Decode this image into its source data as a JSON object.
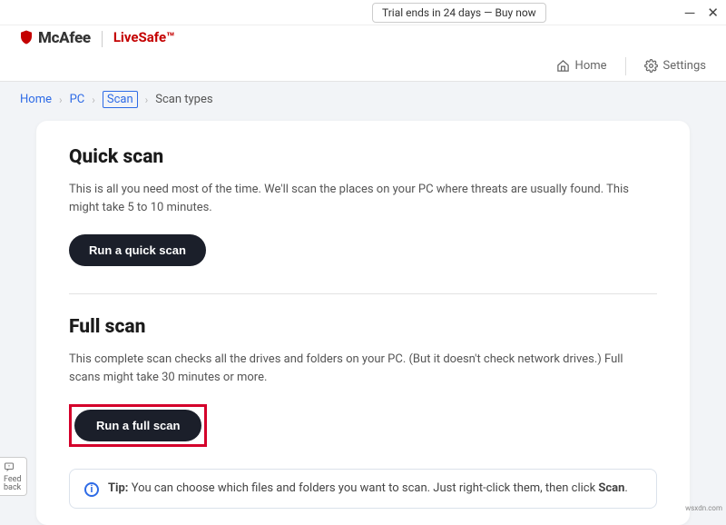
{
  "titlebar": {
    "trial_text": "Trial ends in 24 days — Buy now"
  },
  "brand": {
    "name": "McAfee",
    "product": "LiveSafe™"
  },
  "navbar": {
    "home": "Home",
    "settings": "Settings"
  },
  "crumbs": {
    "home": "Home",
    "pc": "PC",
    "scan": "Scan",
    "types": "Scan types"
  },
  "quick": {
    "title": "Quick scan",
    "text": "This is all you need most of the time. We'll scan the places on your PC where threats are usually found. This might take 5 to 10 minutes.",
    "button": "Run a quick scan"
  },
  "full": {
    "title": "Full scan",
    "text": "This complete scan checks all the drives and folders on your PC. (But it doesn't check network drives.) Full scans might take 30 minutes or more.",
    "button": "Run a full scan"
  },
  "tip": {
    "label": "Tip:",
    "text_before": "You can choose which files and folders you want to scan. Just right-click them, then click ",
    "bold": "Scan",
    "after": "."
  },
  "feedback": "Feed back",
  "watermark": "wsxdn.com"
}
